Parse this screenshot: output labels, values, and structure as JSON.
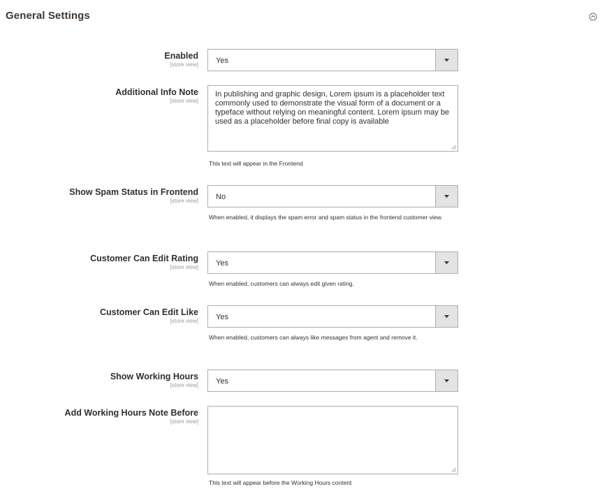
{
  "section": {
    "title": "General Settings"
  },
  "fields": {
    "enabled": {
      "label": "Enabled",
      "scope": "[store view]",
      "value": "Yes"
    },
    "info_note": {
      "label": "Additional Info Note",
      "scope": "[store view]",
      "value": "In publishing and graphic design, Lorem ipsum is a placeholder text commonly used to demonstrate the visual form of a document or a typeface without relying on meaningful content. Lorem ipsum may be used as a placeholder before final copy is available",
      "note": "This text will appear in the Frontend"
    },
    "spam_status": {
      "label": "Show Spam Status in Frontend",
      "scope": "[store view]",
      "value": "No",
      "note": "When enabled, it displays the spam error and spam status in the frontend customer view."
    },
    "edit_rating": {
      "label": "Customer Can Edit Rating",
      "scope": "[store view]",
      "value": "Yes",
      "note": "When enabled, customers can always edit given rating."
    },
    "edit_like": {
      "label": "Customer Can Edit Like",
      "scope": "[store view]",
      "value": "Yes",
      "note": "When enabled, customers can always like messages from agent and remove it."
    },
    "working_hours": {
      "label": "Show Working Hours",
      "scope": "[store view]",
      "value": "Yes"
    },
    "working_hours_note": {
      "label": "Add Working Hours Note Before",
      "scope": "[store view]",
      "value": "",
      "note": "This text will appear before the Working Hours content"
    }
  },
  "icons": {
    "collapse": "collapse-circle-icon",
    "dropdown": "chevron-down-icon",
    "resize": "resize-grip-icon"
  }
}
